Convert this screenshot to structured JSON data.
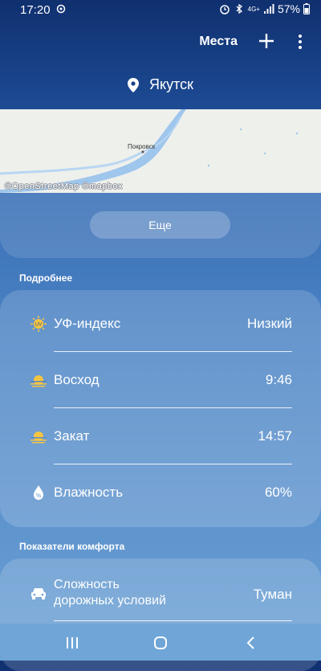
{
  "status_bar": {
    "time": "17:20",
    "battery": "57%",
    "network": "4G+"
  },
  "header": {
    "places_label": "Места"
  },
  "location": {
    "city": "Якутск"
  },
  "map": {
    "town_label": "Покровск",
    "attribution": "©OpenStreetMap ©mapbox"
  },
  "more_button": {
    "label": "Еще"
  },
  "details": {
    "section_title": "Подробнее",
    "rows": [
      {
        "label": "УФ-индекс",
        "value": "Низкий"
      },
      {
        "label": "Восход",
        "value": "9:46"
      },
      {
        "label": "Закат",
        "value": "14:57"
      },
      {
        "label": "Влажность",
        "value": "60%"
      }
    ]
  },
  "comfort": {
    "section_title": "Показатели комфорта",
    "rows": [
      {
        "label_line1": "Сложность",
        "label_line2": "дорожных условий",
        "value": "Туман"
      }
    ]
  },
  "colors": {
    "header_top": "#10306f",
    "accent_sun": "#f5c542"
  }
}
